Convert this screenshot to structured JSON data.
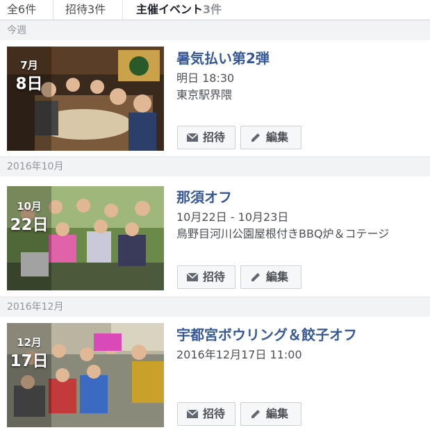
{
  "tabs": [
    {
      "label": "全",
      "count": "6件"
    },
    {
      "label": "招待",
      "count": "3件"
    },
    {
      "label": "主催イベント",
      "count": "3件"
    }
  ],
  "sections": [
    {
      "header": "今週",
      "event": {
        "month": "7月",
        "day": "8日",
        "title": "暑気払い第2弾",
        "time": "明日 18:30",
        "location": "東京駅界隈",
        "photo_desc": "group dinner photo"
      }
    },
    {
      "header": "2016年10月",
      "event": {
        "month": "10月",
        "day": "22日",
        "title": "那須オフ",
        "time": "10月22日 - 10月23日",
        "location": "鳥野目河川公園屋根付きBBQ炉＆コテージ",
        "photo_desc": "outdoor group photo"
      }
    },
    {
      "header": "2016年12月",
      "event": {
        "month": "12月",
        "day": "17日",
        "title": "宇都宮ボウリング＆餃子オフ",
        "time": "2016年12月17日 11:00",
        "location": "",
        "photo_desc": "bowling group photo"
      }
    }
  ],
  "buttons": {
    "invite": "招待",
    "edit": "編集"
  },
  "icons": {
    "invite": "envelope-icon",
    "edit": "pencil-icon"
  },
  "colors": {
    "title": "#365899",
    "header_bg": "#f2f3f5",
    "button_bg": "#f6f7f9"
  }
}
